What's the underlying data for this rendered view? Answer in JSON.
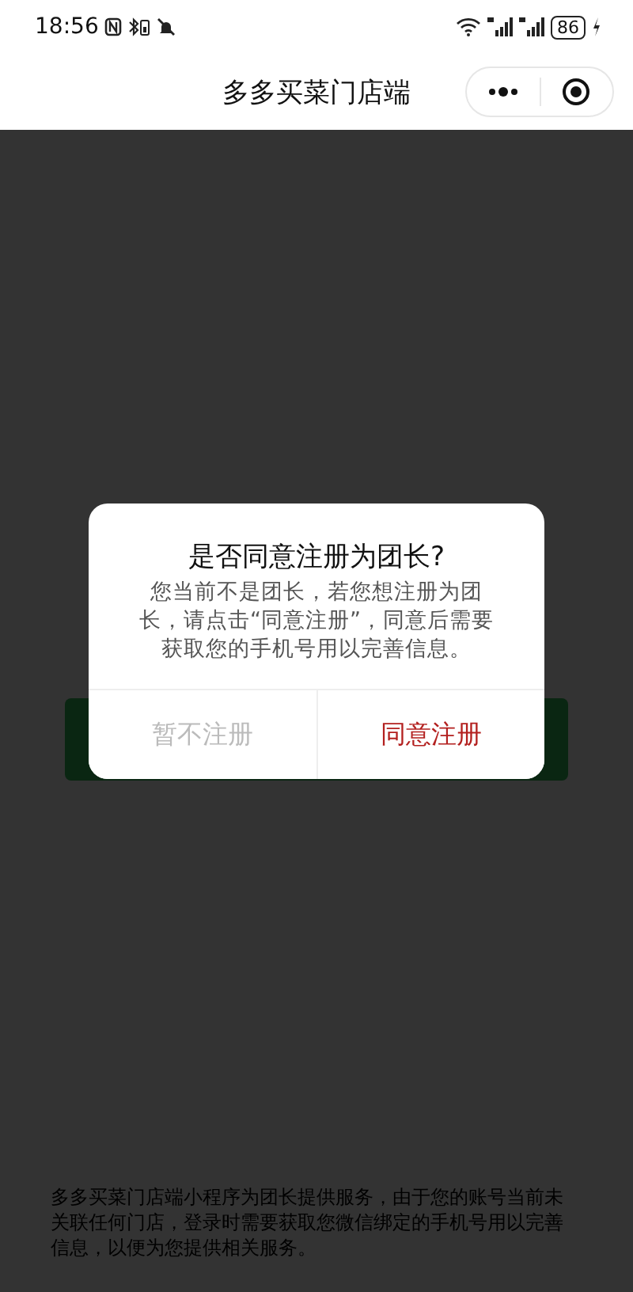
{
  "status_bar": {
    "time": "18:56",
    "battery": "86"
  },
  "nav_bar": {
    "title": "多多买菜门店端"
  },
  "page": {
    "footer_note": "多多买菜门店端小程序为团长提供服务，由于您的账号当前未关联任何门店，登录时需要获取您微信绑定的手机号用以完善信息，以便为您提供相关服务。"
  },
  "dialog": {
    "title": "是否同意注册为团长?",
    "message": "您当前不是团长，若您想注册为团长，请点击“同意注册”，同意后需要获取您的手机号用以完善信息。",
    "buttons": [
      {
        "label": "暂不注册",
        "kind": "cancel"
      },
      {
        "label": "同意注册",
        "kind": "confirm"
      }
    ]
  }
}
